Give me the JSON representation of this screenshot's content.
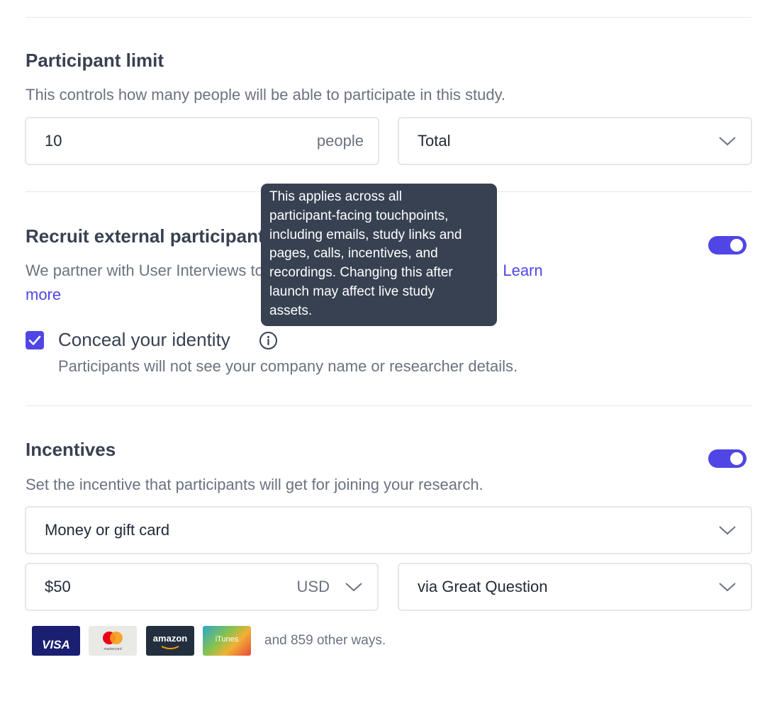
{
  "participant_limit": {
    "title": "Participant limit",
    "description": "This controls how many people will be able to participate in this study.",
    "count_value": "10",
    "count_suffix": "people",
    "period_value": "Total"
  },
  "recruit": {
    "title": "Recruit external participants",
    "description_before": "We partner with User Interviews to recruit B2B and B2C participants.",
    "learn_more_1": "Learn",
    "learn_more_2": "more",
    "toggle_on": true,
    "conceal": {
      "label": "Conceal your identity",
      "checked": true,
      "help": "Participants will not see your company name or researcher details."
    }
  },
  "tooltip": {
    "text": "This applies across all\nparticipant-facing touchpoints,\nincluding emails, study links and\npages, calls, incentives, and\nrecordings. Changing this after\nlaunch may affect live study\nassets."
  },
  "incentives": {
    "title": "Incentives",
    "description": "Set the incentive that participants will get for joining your research.",
    "toggle_on": true,
    "type_value": "Money or gift card",
    "amount_value": "$50",
    "currency_value": "USD",
    "provider_value": "via Great Question",
    "cards": {
      "visa": "VISA",
      "mastercard": "mastercard",
      "amazon": "amazon",
      "itunes": "iTunes"
    },
    "other_ways": "and 859 other ways."
  },
  "colors": {
    "accent": "#5046e5",
    "link": "#4f46e5",
    "tooltip_bg": "#374151"
  }
}
